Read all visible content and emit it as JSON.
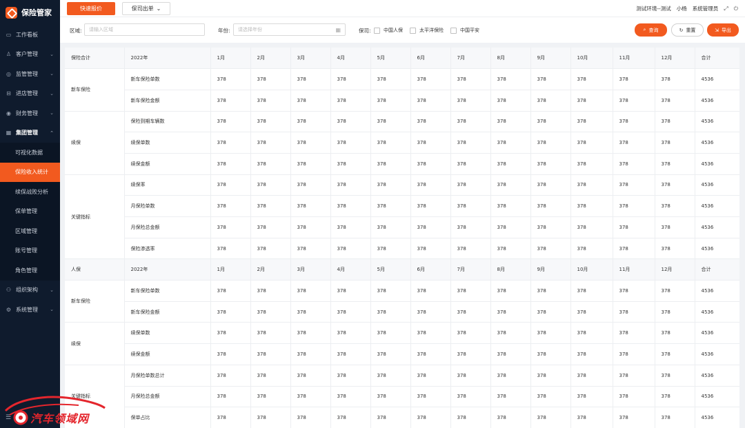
{
  "app": {
    "title": "保险管家"
  },
  "sidebar": {
    "items": [
      {
        "id": "dashboard",
        "label": "工作看板",
        "icon": "monitor-icon",
        "glyph": "▭",
        "chevron": false
      },
      {
        "id": "customer",
        "label": "客户管理",
        "icon": "user-icon",
        "glyph": "♙",
        "chevron": true
      },
      {
        "id": "monitor",
        "label": "监管管理",
        "icon": "shield-icon",
        "glyph": "◎",
        "chevron": true
      },
      {
        "id": "store",
        "label": "进店管理",
        "icon": "car-icon",
        "glyph": "⊟",
        "chevron": true
      },
      {
        "id": "finance",
        "label": "财务管理",
        "icon": "coin-icon",
        "glyph": "◉",
        "chevron": true
      },
      {
        "id": "group",
        "label": "集团管理",
        "icon": "building-icon",
        "glyph": "▦",
        "chevron": true,
        "open": true
      }
    ],
    "submenu": [
      {
        "label": "可视化数据",
        "active": false
      },
      {
        "label": "保险收入统计",
        "active": true
      },
      {
        "label": "续保战败分析",
        "active": false
      },
      {
        "label": "保单管理",
        "active": false
      },
      {
        "label": "区域管理",
        "active": false
      },
      {
        "label": "账号管理",
        "active": false
      },
      {
        "label": "角色管理",
        "active": false
      }
    ],
    "items_after": [
      {
        "id": "org",
        "label": "组织架构",
        "icon": "org-icon",
        "glyph": "⚇",
        "chevron": true
      },
      {
        "id": "system",
        "label": "系统管理",
        "icon": "gear-icon",
        "glyph": "⚙",
        "chevron": true
      }
    ]
  },
  "topbar": {
    "quick_quote": "快速报价",
    "policy_issue": "保司出单",
    "env": "测试环境--测试",
    "user": "小杨",
    "role": "系统管理员"
  },
  "filters": {
    "region_label": "区域:",
    "region_placeholder": "请输入区域",
    "year_label": "年份:",
    "year_placeholder": "请选择年份",
    "insurer_label": "保司:",
    "insurers": [
      "中国人保",
      "太平洋保险",
      "中国平安"
    ],
    "query": "查询",
    "reset": "重置",
    "export": "导出"
  },
  "table": {
    "months": [
      "1月",
      "2月",
      "3月",
      "4月",
      "5月",
      "6月",
      "7月",
      "8月",
      "9月",
      "10月",
      "11月",
      "12月",
      "合计"
    ],
    "row_value": "378",
    "row_total": "4536",
    "sections": [
      {
        "title": "保险合计",
        "year": "2022年",
        "groups": [
          {
            "name": "新车保险",
            "metrics": [
              "新车保险单数",
              "新车保险金额"
            ]
          },
          {
            "name": "续保",
            "metrics": [
              "保险到期车辆数",
              "续保单数",
              "续保金额"
            ]
          },
          {
            "name": "关键指标",
            "metrics": [
              "续保率",
              "月保险单数",
              "月保险总金额",
              "保险渗透率"
            ]
          }
        ]
      },
      {
        "title": "人保",
        "year": "2022年",
        "groups": [
          {
            "name": "新车保险",
            "metrics": [
              "新车保险单数",
              "新车保险金额"
            ]
          },
          {
            "name": "续保",
            "metrics": [
              "续保单数",
              "续保金额"
            ]
          },
          {
            "name": "关键指标",
            "metrics": [
              "月保险单数总计",
              "月保险总金额",
              "保单占比"
            ]
          }
        ]
      }
    ]
  },
  "watermark": {
    "text": "汽车领域网"
  }
}
